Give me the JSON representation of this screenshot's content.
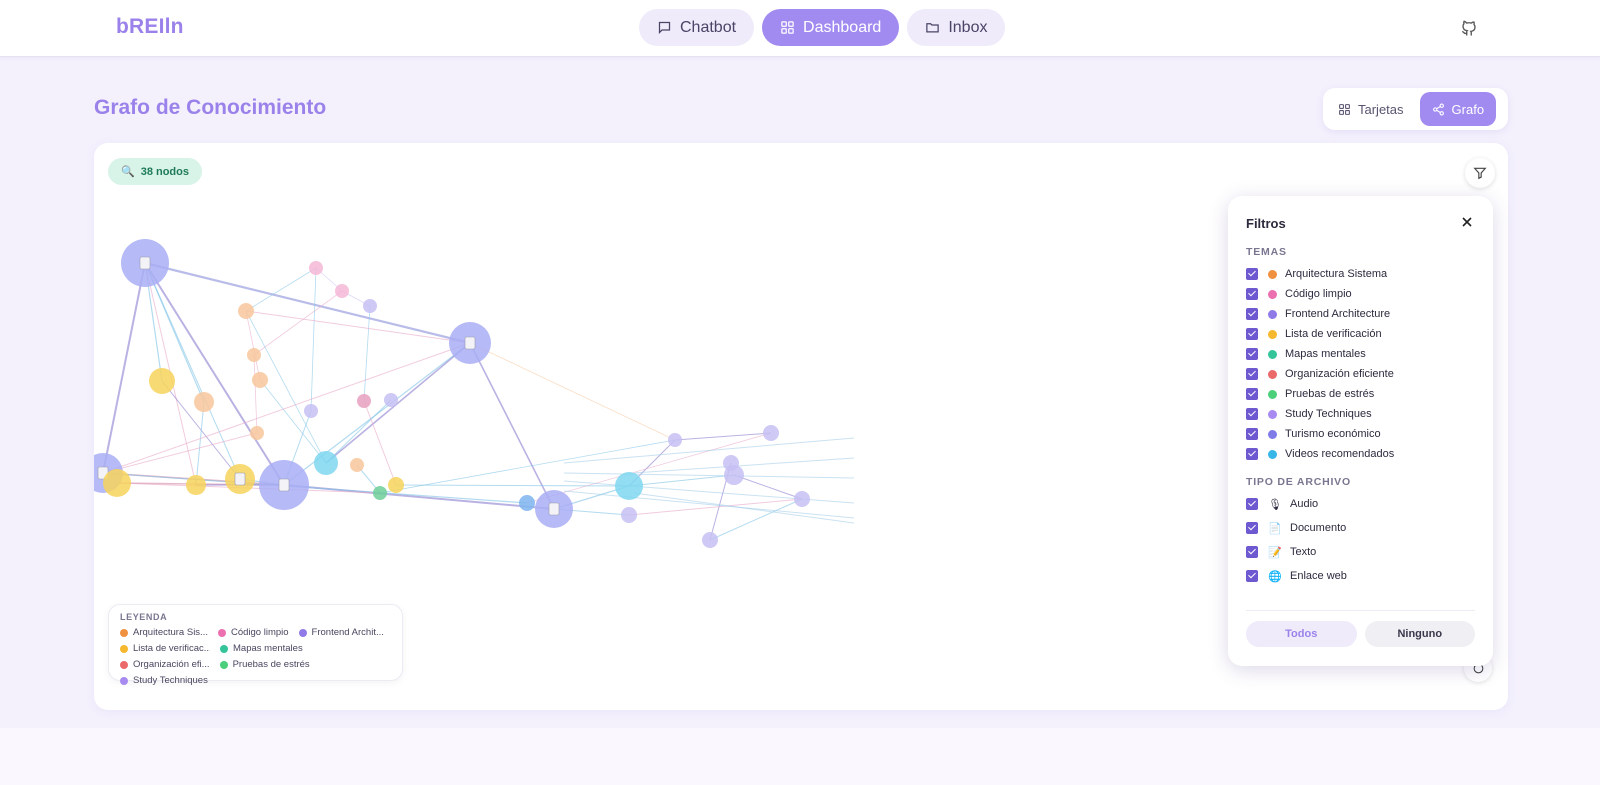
{
  "app": {
    "logo": "bREIln"
  },
  "nav": [
    {
      "label": "Chatbot",
      "icon": "chat-icon",
      "active": false
    },
    {
      "label": "Dashboard",
      "icon": "dashboard-icon",
      "active": true
    },
    {
      "label": "Inbox",
      "icon": "folder-icon",
      "active": false
    }
  ],
  "page": {
    "title": "Grafo de Conocimiento",
    "view_toggle": {
      "cards_label": "Tarjetas",
      "graph_label": "Grafo",
      "active": "Grafo"
    }
  },
  "graph": {
    "node_count_label": "38 nodos",
    "legend": {
      "title": "LEYENDA",
      "items": [
        {
          "label": "Arquitectura Sis...",
          "color": "#f0913f"
        },
        {
          "label": "Código limpio",
          "color": "#ec6fb0"
        },
        {
          "label": "Frontend Archit...",
          "color": "#8f7ae8"
        },
        {
          "label": "Lista de verificac...",
          "color": "#f5b82e"
        },
        {
          "label": "Mapas mentales",
          "color": "#35c49a"
        },
        {
          "label": "Organización efi...",
          "color": "#ea6a6a"
        },
        {
          "label": "Pruebas de estrés",
          "color": "#4ccf7a"
        },
        {
          "label": "Study Techniques",
          "color": "#a78bf0"
        }
      ]
    }
  },
  "filters": {
    "title": "Filtros",
    "topics_heading": "TEMAS",
    "topics": [
      {
        "label": "Arquitectura Sistema",
        "color": "#f0913f",
        "checked": true
      },
      {
        "label": "Código limpio",
        "color": "#ec6fb0",
        "checked": true
      },
      {
        "label": "Frontend Architecture",
        "color": "#8f7ae8",
        "checked": true
      },
      {
        "label": "Lista de verificación",
        "color": "#f5b82e",
        "checked": true
      },
      {
        "label": "Mapas mentales",
        "color": "#35c49a",
        "checked": true
      },
      {
        "label": "Organización eficiente",
        "color": "#ea6a6a",
        "checked": true
      },
      {
        "label": "Pruebas de estrés",
        "color": "#4ccf7a",
        "checked": true
      },
      {
        "label": "Study Techniques",
        "color": "#a78bf0",
        "checked": true
      },
      {
        "label": "Turismo económico",
        "color": "#7f7ce8",
        "checked": true
      },
      {
        "label": "Videos recomendados",
        "color": "#37b6e8",
        "checked": true
      }
    ],
    "filetype_heading": "TIPO DE ARCHIVO",
    "filetypes": [
      {
        "label": "Audio",
        "icon": "microphone-icon",
        "checked": true
      },
      {
        "label": "Documento",
        "icon": "document-icon",
        "checked": true
      },
      {
        "label": "Texto",
        "icon": "memo-icon",
        "checked": true
      },
      {
        "label": "Enlace web",
        "icon": "globe-icon",
        "checked": true
      }
    ],
    "all_label": "Todos",
    "none_label": "Ninguno"
  }
}
